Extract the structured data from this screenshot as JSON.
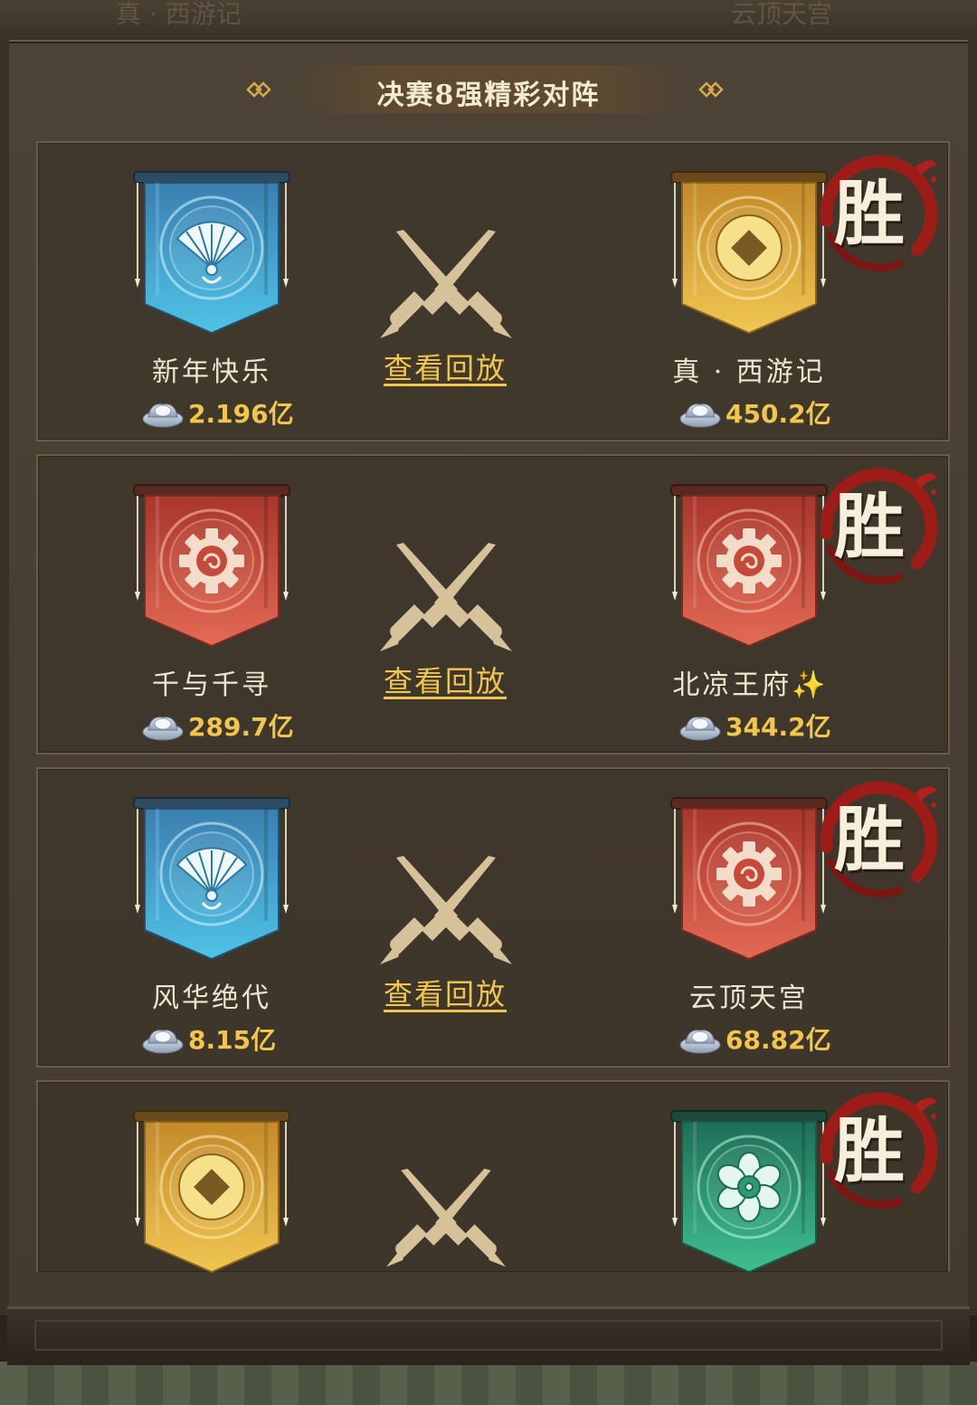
{
  "background": {
    "ghost_left": "真 · 西游记",
    "ghost_right": "云顶天宫"
  },
  "header": {
    "title": "决赛8强精彩对阵"
  },
  "colors": {
    "gold": "#f2c64d",
    "banner_blue": "#2f8fb8",
    "banner_red": "#c9483a",
    "banner_gold": "#d7a63b",
    "banner_green": "#2e9a73",
    "win_ring": "#b0201c"
  },
  "matches": [
    {
      "left": {
        "name": "新年快乐",
        "coins": "2.196亿",
        "banner_color": "blue",
        "emblem": "fan-emblem"
      },
      "right": {
        "name": "真 · 西游记",
        "coins": "450.2亿",
        "banner_color": "gold",
        "emblem": "coin-emblem"
      },
      "replay_label": "查看回放",
      "win_label": "胜",
      "winner": "right"
    },
    {
      "left": {
        "name": "千与千寻",
        "coins": "289.7亿",
        "banner_color": "red",
        "emblem": "gear-emblem"
      },
      "right": {
        "name": "北凉王府",
        "name_suffix": "✨",
        "coins": "344.2亿",
        "banner_color": "red",
        "emblem": "gear-emblem"
      },
      "replay_label": "查看回放",
      "win_label": "胜",
      "winner": "right"
    },
    {
      "left": {
        "name": "风华绝代",
        "coins": "8.15亿",
        "banner_color": "blue",
        "emblem": "fan-emblem"
      },
      "right": {
        "name": "云顶天宫",
        "coins": "68.82亿",
        "banner_color": "red",
        "emblem": "gear-emblem"
      },
      "replay_label": "查看回放",
      "win_label": "胜",
      "winner": "right"
    },
    {
      "left": {
        "banner_color": "gold",
        "emblem": "coin-emblem"
      },
      "right": {
        "banner_color": "green",
        "emblem": "flower-emblem"
      },
      "win_label": "胜",
      "winner": "right"
    }
  ]
}
